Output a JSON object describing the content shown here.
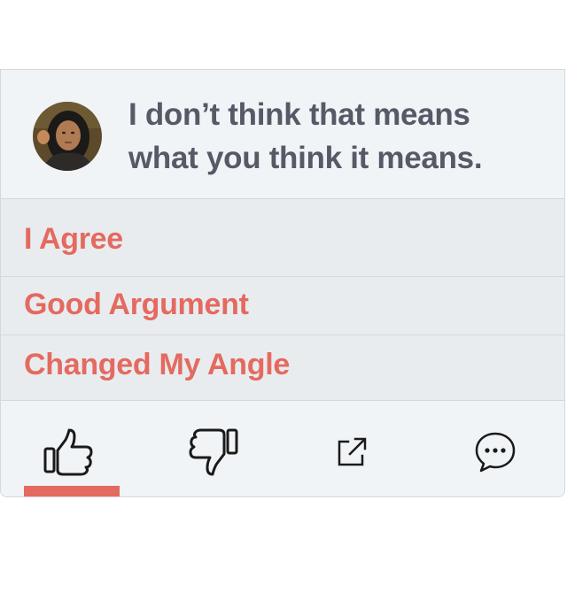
{
  "quote": {
    "text_line1": "I don’t think that means",
    "text_line2": "what you think it means."
  },
  "reactions": [
    {
      "label": "I Agree"
    },
    {
      "label": "Good Argument"
    },
    {
      "label": "Changed My Angle"
    }
  ],
  "actions": {
    "items": [
      "thumbs-up-icon",
      "thumbs-down-icon",
      "share-icon",
      "comment-icon"
    ],
    "active": "thumbs-up-icon"
  },
  "colors": {
    "accent": "#e46a60",
    "text": "#555a66",
    "background": "#e9ecef",
    "panel": "#f1f4f7"
  }
}
